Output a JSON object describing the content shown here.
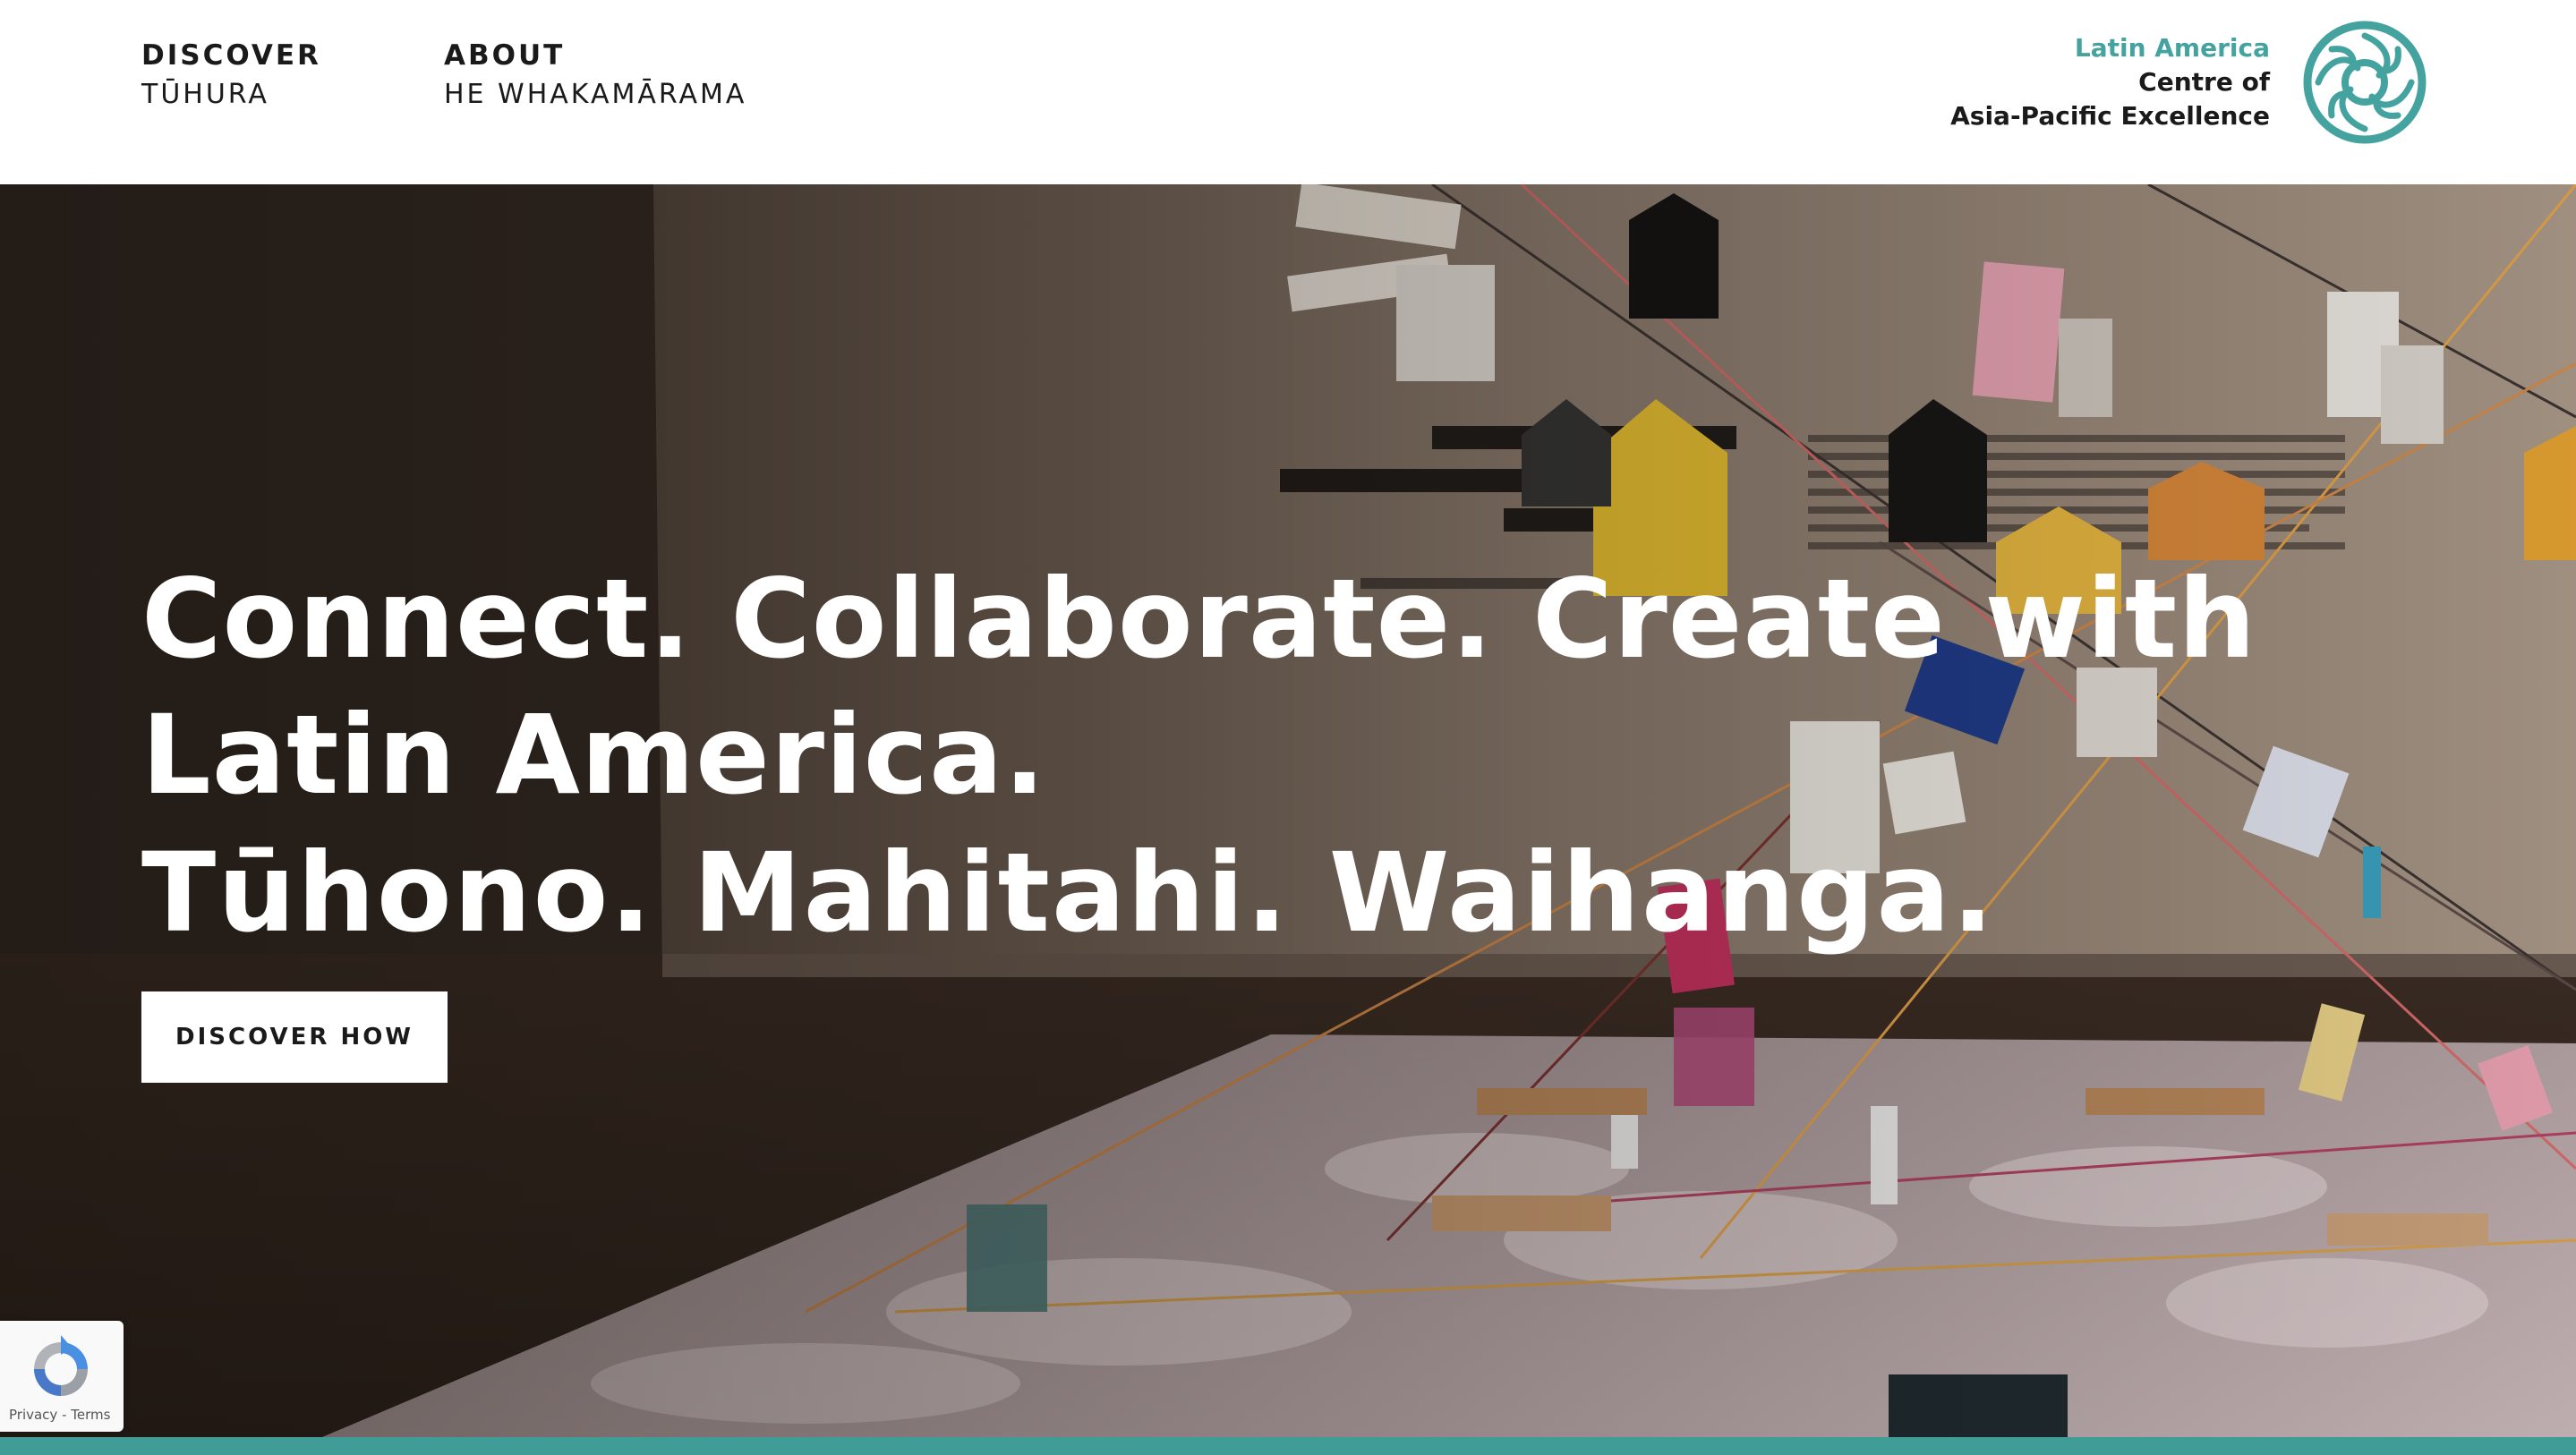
{
  "nav": {
    "discover": {
      "label": "DISCOVER",
      "sublabel": "TŪHURA"
    },
    "about": {
      "label": "ABOUT",
      "sublabel": "HE WHAKAMĀRAMA"
    }
  },
  "brand": {
    "line1": "Latin America",
    "line2": "Centre of",
    "line3": "Asia-Pacific Excellence",
    "logo_icon": "celtic-knot-circle-logo",
    "accent_color": "#45a39f"
  },
  "hero": {
    "title": "Connect. Collaborate. Create with Latin America.",
    "subtitle": "Tūhono. Mahitahi. Waihanga.",
    "cta_label": "DISCOVER HOW",
    "background_description_icon": "gallery-installation-photo"
  },
  "recaptcha": {
    "icon": "recaptcha-icon",
    "privacy": "Privacy",
    "separator": " - ",
    "terms": "Terms"
  },
  "colors": {
    "teal": "#3f9c97",
    "text_dark": "#1a1a1a",
    "white": "#ffffff"
  }
}
